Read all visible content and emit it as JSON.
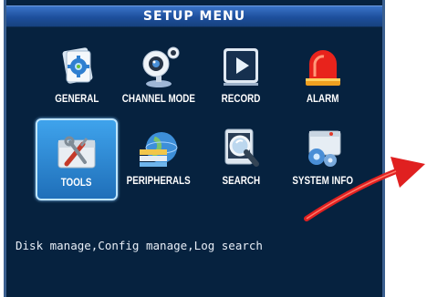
{
  "title": "SETUP  MENU",
  "menu": [
    {
      "label": "GENERAL",
      "icon": "gear-document-icon"
    },
    {
      "label": "CHANNEL MODE",
      "icon": "webcam-icon"
    },
    {
      "label": "RECORD",
      "icon": "play-screen-icon"
    },
    {
      "label": "ALARM",
      "icon": "siren-light-icon"
    },
    {
      "label": "TOOLS",
      "icon": "toolbox-icon"
    },
    {
      "label": "PERIPHERALS",
      "icon": "globe-network-icon"
    },
    {
      "label": "SEARCH",
      "icon": "magnifier-screen-icon"
    },
    {
      "label": "SYSTEM INFO",
      "icon": "system-gears-icon"
    }
  ],
  "selected_item": "TOOLS",
  "status_text": "Disk manage,Config manage,Log search",
  "colors": {
    "background": "#06223f",
    "title_bar": "#1d4f9c",
    "selection": "#2f8fd8",
    "arrow": "#e02020"
  }
}
